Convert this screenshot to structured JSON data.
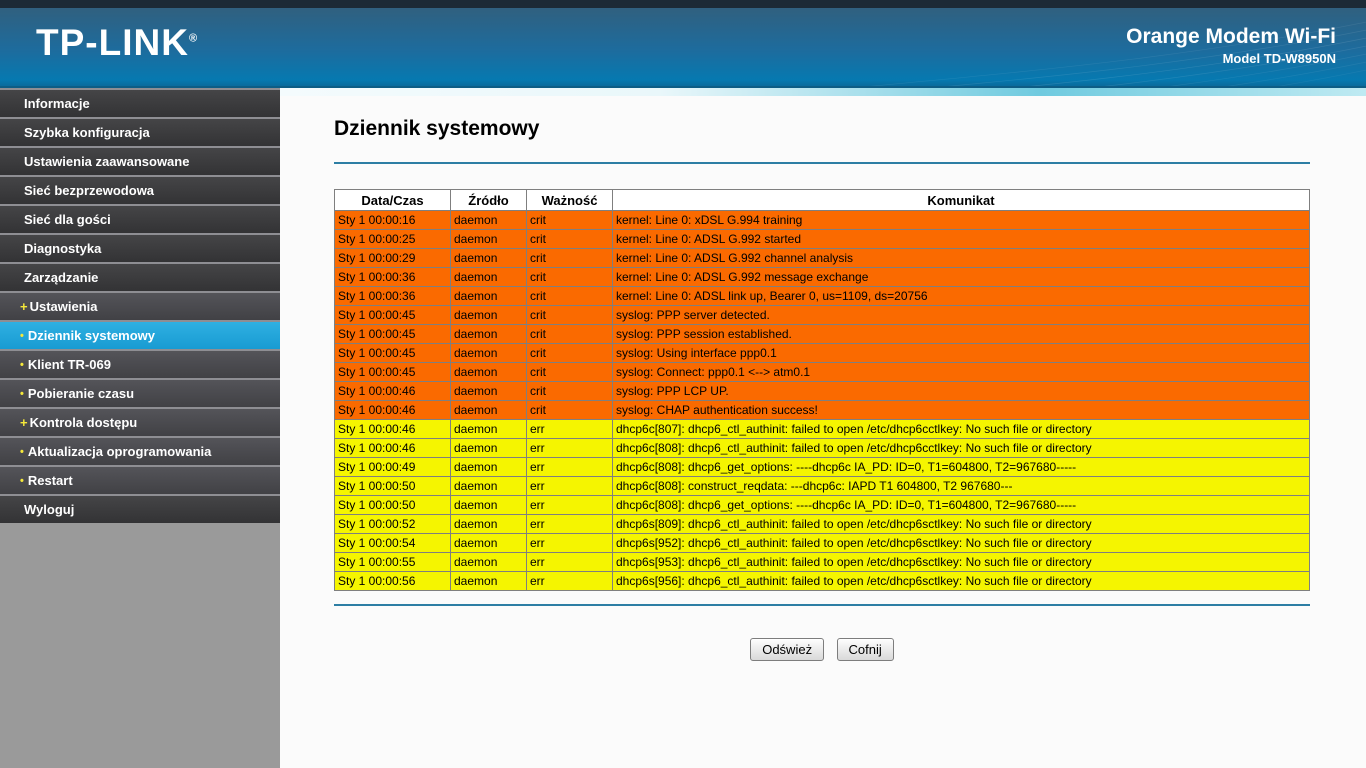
{
  "header": {
    "logo": "TP-LINK",
    "registered_mark": "®",
    "product": "Orange Modem Wi-Fi",
    "model": "Model TD-W8950N"
  },
  "sidebar": {
    "items": [
      {
        "label": "Informacje",
        "type": "section"
      },
      {
        "label": "Szybka konfiguracja",
        "type": "section"
      },
      {
        "label": "Ustawienia zaawansowane",
        "type": "section"
      },
      {
        "label": "Sieć bezprzewodowa",
        "type": "section"
      },
      {
        "label": "Sieć dla gości",
        "type": "section"
      },
      {
        "label": "Diagnostyka",
        "type": "section"
      },
      {
        "label": "Zarządzanie",
        "type": "section"
      },
      {
        "label": "Ustawienia",
        "type": "sub",
        "bullet": "+"
      },
      {
        "label": "Dziennik systemowy",
        "type": "sub",
        "bullet": "•",
        "selected": true
      },
      {
        "label": "Klient TR-069",
        "type": "sub",
        "bullet": "•"
      },
      {
        "label": "Pobieranie czasu",
        "type": "sub",
        "bullet": "•"
      },
      {
        "label": "Kontrola dostępu",
        "type": "sub",
        "bullet": "+"
      },
      {
        "label": "Aktualizacja oprogramowania",
        "type": "sub",
        "bullet": "•"
      },
      {
        "label": "Restart",
        "type": "sub",
        "bullet": "•"
      },
      {
        "label": "Wyloguj",
        "type": "section"
      }
    ]
  },
  "main": {
    "title": "Dziennik systemowy",
    "table": {
      "columns": [
        "Data/Czas",
        "Źródło",
        "Ważność",
        "Komunikat"
      ],
      "rows": [
        {
          "time": "Sty 1 00:00:16",
          "src": "daemon",
          "sev": "crit",
          "msg": "kernel: Line 0: xDSL G.994 training"
        },
        {
          "time": "Sty 1 00:00:25",
          "src": "daemon",
          "sev": "crit",
          "msg": "kernel: Line 0: ADSL G.992 started"
        },
        {
          "time": "Sty 1 00:00:29",
          "src": "daemon",
          "sev": "crit",
          "msg": "kernel: Line 0: ADSL G.992 channel analysis"
        },
        {
          "time": "Sty 1 00:00:36",
          "src": "daemon",
          "sev": "crit",
          "msg": "kernel: Line 0: ADSL G.992 message exchange"
        },
        {
          "time": "Sty 1 00:00:36",
          "src": "daemon",
          "sev": "crit",
          "msg": "kernel: Line 0: ADSL link up, Bearer 0, us=1109, ds=20756"
        },
        {
          "time": "Sty 1 00:00:45",
          "src": "daemon",
          "sev": "crit",
          "msg": "syslog: PPP server detected."
        },
        {
          "time": "Sty 1 00:00:45",
          "src": "daemon",
          "sev": "crit",
          "msg": "syslog: PPP session established."
        },
        {
          "time": "Sty 1 00:00:45",
          "src": "daemon",
          "sev": "crit",
          "msg": "syslog: Using interface ppp0.1"
        },
        {
          "time": "Sty 1 00:00:45",
          "src": "daemon",
          "sev": "crit",
          "msg": "syslog: Connect: ppp0.1 <--> atm0.1"
        },
        {
          "time": "Sty 1 00:00:46",
          "src": "daemon",
          "sev": "crit",
          "msg": "syslog: PPP LCP UP."
        },
        {
          "time": "Sty 1 00:00:46",
          "src": "daemon",
          "sev": "crit",
          "msg": "syslog: CHAP authentication success!"
        },
        {
          "time": "Sty 1 00:00:46",
          "src": "daemon",
          "sev": "err",
          "msg": "dhcp6c[807]: dhcp6_ctl_authinit: failed to open /etc/dhcp6cctlkey: No such file or directory"
        },
        {
          "time": "Sty 1 00:00:46",
          "src": "daemon",
          "sev": "err",
          "msg": "dhcp6c[808]: dhcp6_ctl_authinit: failed to open /etc/dhcp6cctlkey: No such file or directory"
        },
        {
          "time": "Sty 1 00:00:49",
          "src": "daemon",
          "sev": "err",
          "msg": "dhcp6c[808]: dhcp6_get_options: ----dhcp6c IA_PD: ID=0, T1=604800, T2=967680-----"
        },
        {
          "time": "Sty 1 00:00:50",
          "src": "daemon",
          "sev": "err",
          "msg": "dhcp6c[808]: construct_reqdata: ---dhcp6c: IAPD T1 604800, T2 967680---"
        },
        {
          "time": "Sty 1 00:00:50",
          "src": "daemon",
          "sev": "err",
          "msg": "dhcp6c[808]: dhcp6_get_options: ----dhcp6c IA_PD: ID=0, T1=604800, T2=967680-----"
        },
        {
          "time": "Sty 1 00:00:52",
          "src": "daemon",
          "sev": "err",
          "msg": "dhcp6s[809]: dhcp6_ctl_authinit: failed to open /etc/dhcp6sctlkey: No such file or directory"
        },
        {
          "time": "Sty 1 00:00:54",
          "src": "daemon",
          "sev": "err",
          "msg": "dhcp6s[952]: dhcp6_ctl_authinit: failed to open /etc/dhcp6sctlkey: No such file or directory"
        },
        {
          "time": "Sty 1 00:00:55",
          "src": "daemon",
          "sev": "err",
          "msg": "dhcp6s[953]: dhcp6_ctl_authinit: failed to open /etc/dhcp6sctlkey: No such file or directory"
        },
        {
          "time": "Sty 1 00:00:56",
          "src": "daemon",
          "sev": "err",
          "msg": "dhcp6s[956]: dhcp6_ctl_authinit: failed to open /etc/dhcp6sctlkey: No such file or directory"
        }
      ]
    },
    "buttons": {
      "refresh": "Odśwież",
      "back": "Cofnij"
    }
  },
  "colors": {
    "severity": {
      "crit": "#fa6a00",
      "err": "#f5f500"
    },
    "selected_nav": "linear-gradient(#2fb0e2, #189bd2)",
    "accent_rule": "#2d7ea4",
    "header_gradient_top": "#30607f",
    "header_gradient_bottom": "#0679b0"
  }
}
